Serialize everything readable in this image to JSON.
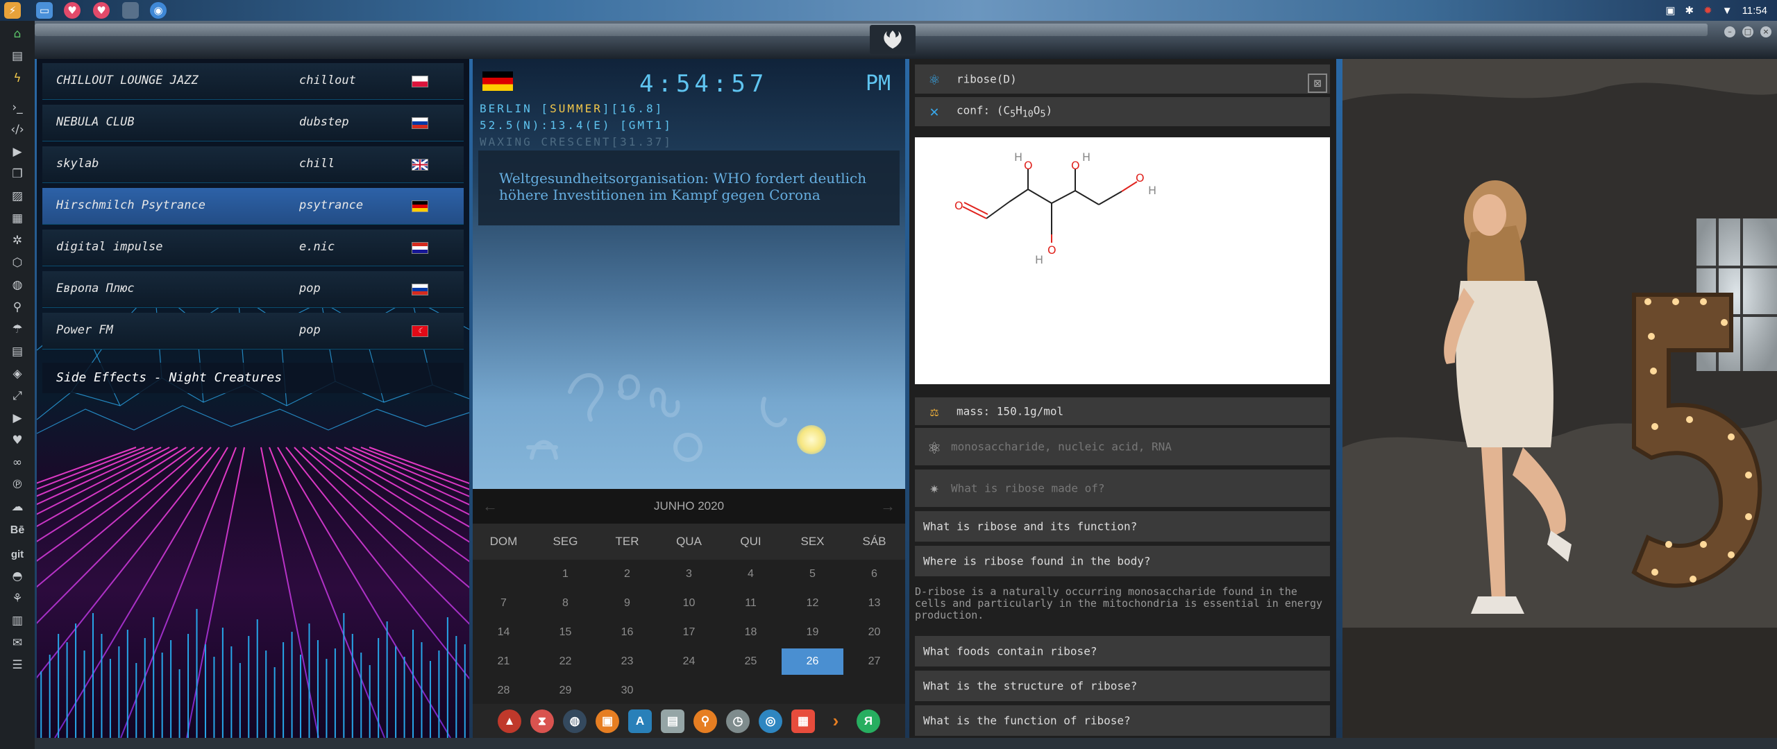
{
  "system": {
    "clock": "11:54"
  },
  "radio": {
    "stations": [
      {
        "name": "CHILLOUT LOUNGE JAZZ",
        "genre": "chillout",
        "flag": "poland"
      },
      {
        "name": "NEBULA CLUB",
        "genre": "dubstep",
        "flag": "russia"
      },
      {
        "name": "skylab",
        "genre": "chill",
        "flag": "uk"
      },
      {
        "name": "Hirschmilch Psytrance",
        "genre": "psytrance",
        "flag": "germany"
      },
      {
        "name": "digital impulse",
        "genre": "e.nic",
        "flag": "croatia"
      },
      {
        "name": "Европа Плюс",
        "genre": "pop",
        "flag": "russia"
      },
      {
        "name": "Power FM",
        "genre": "pop",
        "flag": "turkey"
      }
    ],
    "active_index": 3,
    "now_playing": "Side Effects - Night Creatures",
    "equalizer_levels": [
      0.32,
      0.4,
      0.5,
      0.46,
      0.55,
      0.42,
      0.6,
      0.5,
      0.38,
      0.44,
      0.52,
      0.36,
      0.48,
      0.58,
      0.41,
      0.47,
      0.33,
      0.5,
      0.62,
      0.45,
      0.39,
      0.53,
      0.44,
      0.36,
      0.49,
      0.57,
      0.42,
      0.34,
      0.46,
      0.51,
      0.4,
      0.55,
      0.47,
      0.38,
      0.43,
      0.6,
      0.5,
      0.41,
      0.35,
      0.48,
      0.56,
      0.44,
      0.39,
      0.52,
      0.46,
      0.37,
      0.42,
      0.58,
      0.49,
      0.45
    ]
  },
  "clock": {
    "time": "4:54:57",
    "ampm": "PM",
    "location_line1_prefix": "BERLIN [",
    "season": "SUMMER",
    "location_line1_suffix": "][16.8]",
    "location_line2": "52.5(N):13.4(E) [GMT1]",
    "moon_phase": "WAXING CRESCENT[31.37]",
    "news": "Weltgesundheitsorganisation: WHO fordert deutlich höhere Investitionen im Kampf gegen Corona"
  },
  "calendar": {
    "month": "JUNHO 2020",
    "weekdays": [
      "DOM",
      "SEG",
      "TER",
      "QUA",
      "QUI",
      "SEX",
      "SÁB"
    ],
    "weeks": [
      [
        "",
        "1",
        "2",
        "3",
        "4",
        "5",
        "6"
      ],
      [
        "7",
        "8",
        "9",
        "10",
        "11",
        "12",
        "13"
      ],
      [
        "14",
        "15",
        "16",
        "17",
        "18",
        "19",
        "20"
      ],
      [
        "21",
        "22",
        "23",
        "24",
        "25",
        "26",
        "27"
      ],
      [
        "28",
        "29",
        "30",
        "",
        "",
        "",
        ""
      ]
    ],
    "selected": "26"
  },
  "launcher": {
    "apps": [
      {
        "icon": "red-arrow-icon",
        "color": "#c0392b"
      },
      {
        "icon": "hourglass-icon",
        "color": "#d9534f"
      },
      {
        "icon": "globe-dark-icon",
        "color": "#34495e"
      },
      {
        "icon": "image-viewer-icon",
        "color": "#e67e22"
      },
      {
        "icon": "translate-icon",
        "color": "#2980b9"
      },
      {
        "icon": "news-icon",
        "color": "#95a5a6"
      },
      {
        "icon": "search-icon",
        "color": "#e67e22"
      },
      {
        "icon": "clock-icon",
        "color": "#7f8c8d"
      },
      {
        "icon": "browser-globe-icon",
        "color": "#2e86c1"
      },
      {
        "icon": "calendar-icon",
        "color": "#e74c3c"
      },
      {
        "icon": "chevron-right-icon",
        "color": "#e67e22"
      },
      {
        "icon": "yandex-icon",
        "color": "#27ae60",
        "label": "Я"
      }
    ]
  },
  "chem": {
    "name": "ribose(D)",
    "conf_prefix": "conf: (C",
    "formula": {
      "c": "5",
      "h": "10",
      "o": "5"
    },
    "conf_suffix": ")",
    "mass": "mass: 150.1g/mol",
    "classes": "monosaccharide, nucleic acid, RNA",
    "q_made_of": "What is ribose made of?",
    "questions_a": [
      "What is ribose and its function?",
      "Where is ribose found in the body?"
    ],
    "answer": "D-ribose is a naturally occurring monosaccharide found in the cells and particularly in the mitochondria is essential in energy production.",
    "questions_b": [
      "What foods contain ribose?",
      "What is the structure of ribose?",
      "What is the function of ribose?"
    ],
    "atoms": {
      "o": "O",
      "h": "H"
    }
  },
  "colors": {
    "accent": "#5fc4f0",
    "season": "#f3c84a",
    "selected_day": "#4a8fd1",
    "station_active": "#2d62a8"
  }
}
